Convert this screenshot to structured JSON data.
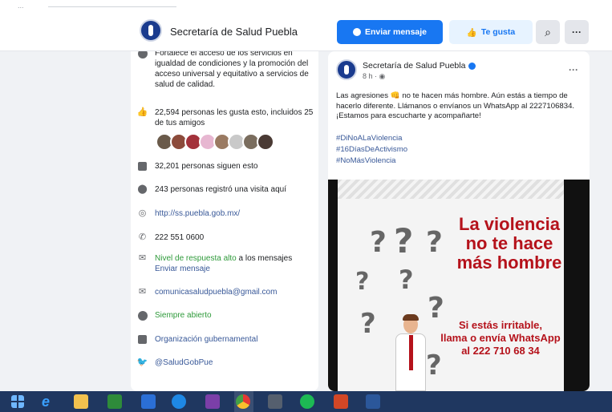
{
  "browser": {
    "menu_dots": "..."
  },
  "header": {
    "page_name": "Secretaría de Salud Puebla",
    "send_message_label": "Enviar mensaje",
    "like_label": "Te gusta",
    "search_icon": "search-icon",
    "more_label": "···"
  },
  "about": {
    "description": "Fortalece el acceso de los servicios en igualdad de condiciones y la promoción del acceso universal y equitativo a servicios de salud de calidad.",
    "likes": "22,594 personas les gusta esto, incluidos 25 de tus amigos",
    "followers": "32,201 personas siguen esto",
    "checkins": "243 personas registró una visita aquí",
    "website": "http://ss.puebla.gob.mx/",
    "phone": "222 551 0600",
    "response_prefix": "Nivel de respuesta alto",
    "response_suffix": " a los mensajes",
    "send_message_link": "Enviar mensaje",
    "email": "comunicasaludpuebla@gmail.com",
    "hours": "Siempre abierto",
    "category": "Organización gubernamental",
    "twitter": "@SaludGobPue"
  },
  "post": {
    "author": "Secretaría de Salud Puebla",
    "time": "8 h · ",
    "more": "···",
    "text": "Las agresiones 👊 no te hacen más hombre. Aún estás a tiempo de hacerlo diferente. Llámanos o envíanos un WhatsApp al 2227106834. ¡Estamos para escucharte y acompañarte!",
    "hashtags": [
      "#DiNoALaViolencia",
      "#16DíasDeActivismo",
      "#NoMásViolencia"
    ],
    "image": {
      "headline_1": "La violencia",
      "headline_2": "no te hace",
      "headline_3": "más hombre",
      "sub_1": "Si estás irritable,",
      "sub_2": "llama o envía WhatsApp",
      "sub_3": "al 222 710 68 34"
    }
  },
  "taskbar": {
    "apps": [
      "start",
      "internet-explorer",
      "file-explorer",
      "store",
      "outlook",
      "hp",
      "onenote",
      "chrome",
      "app",
      "spotify",
      "powerpoint",
      "word"
    ]
  }
}
